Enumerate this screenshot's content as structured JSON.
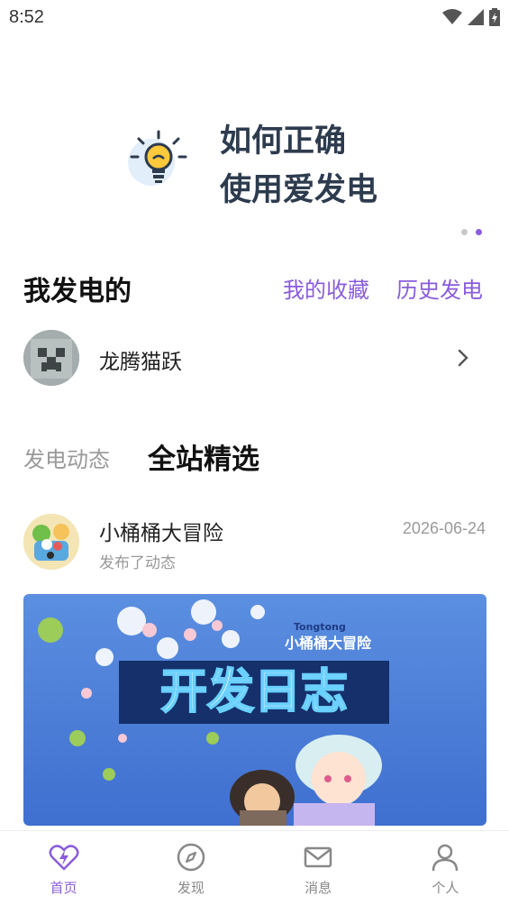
{
  "status_bar": {
    "time": "8:52"
  },
  "banner": {
    "line1": "如何正确",
    "line2": "使用爱发电",
    "active_dot": 2,
    "dot_count": 2
  },
  "section": {
    "title": "我发电的",
    "favorites_label": "我的收藏",
    "history_label": "历史发电"
  },
  "creator": {
    "name": "龙腾猫跃"
  },
  "tabs": {
    "dynamic": "发电动态",
    "featured": "全站精选"
  },
  "post": {
    "author": "小桶桶大冒险",
    "subtitle": "发布了动态",
    "date": "2026-06-24",
    "image_logo_small": "Tongtong",
    "image_logo": "小桶桶大冒险",
    "image_title": "开发日志"
  },
  "nav": [
    {
      "label": "首页",
      "icon": "home-bolt-icon",
      "active": true
    },
    {
      "label": "发现",
      "icon": "compass-icon",
      "active": false
    },
    {
      "label": "消息",
      "icon": "mail-icon",
      "active": false
    },
    {
      "label": "个人",
      "icon": "person-icon",
      "active": false
    }
  ],
  "colors": {
    "accent": "#8a5cdb",
    "text_dark": "#2d3b4e"
  }
}
